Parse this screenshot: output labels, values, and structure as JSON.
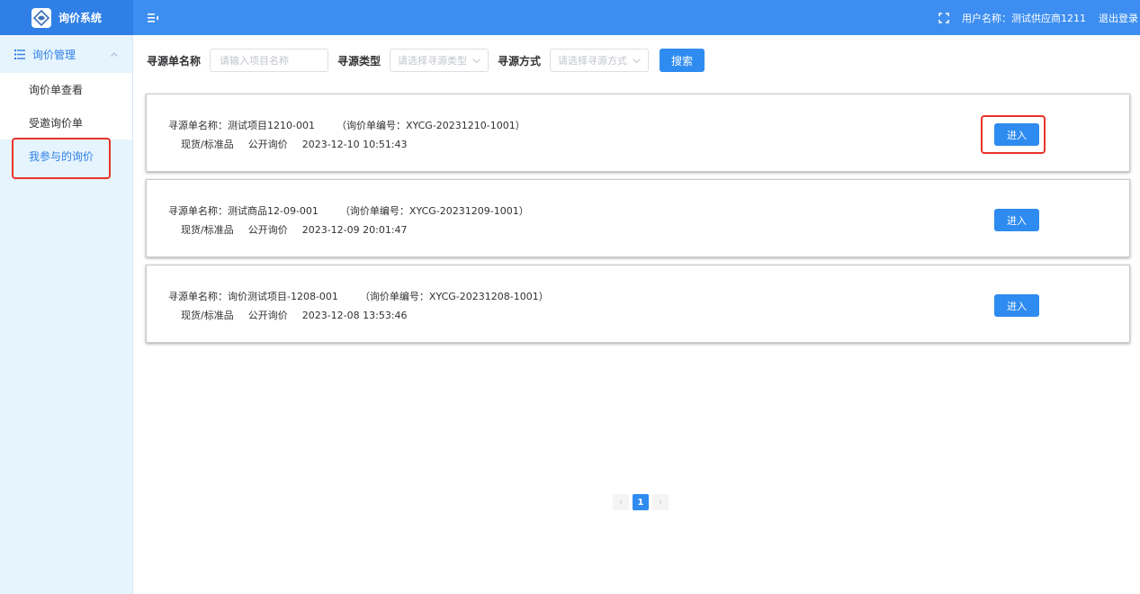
{
  "header": {
    "app_title": "询价系统",
    "user_label": "用户名称：测试供应商1211",
    "logout_label": "退出登录"
  },
  "sidebar": {
    "group_label": "询价管理",
    "items": [
      {
        "label": "询价单查看"
      },
      {
        "label": "受邀询价单"
      },
      {
        "label": "我参与的询价"
      }
    ]
  },
  "search": {
    "name_label": "寻源单名称",
    "name_placeholder": "请输入项目名称",
    "type_label": "寻源类型",
    "type_placeholder": "请选择寻源类型",
    "method_label": "寻源方式",
    "method_placeholder": "请选择寻源方式",
    "button_label": "搜索"
  },
  "cards": [
    {
      "name": "寻源单名称：测试项目1210-001",
      "code": "（询价单编号：XYCG-20231210-1001）",
      "category": "现货/标准品",
      "method": "公开询价",
      "time": "2023-12-10 10:51:43",
      "button": "进入"
    },
    {
      "name": "寻源单名称：测试商品12-09-001",
      "code": "（询价单编号：XYCG-20231209-1001）",
      "category": "现货/标准品",
      "method": "公开询价",
      "time": "2023-12-09 20:01:47",
      "button": "进入"
    },
    {
      "name": "寻源单名称：询价测试项目-1208-001",
      "code": "（询价单编号：XYCG-20231208-1001）",
      "category": "现货/标准品",
      "method": "公开询价",
      "time": "2023-12-08 13:53:46",
      "button": "进入"
    }
  ],
  "pagination": {
    "current": "1",
    "prev": "‹",
    "next": "›"
  },
  "colors": {
    "header": "#3d8ef0",
    "primary": "#2e8bf0",
    "sidebar_bg": "#e6f4fd",
    "highlight": "#e8332a"
  }
}
